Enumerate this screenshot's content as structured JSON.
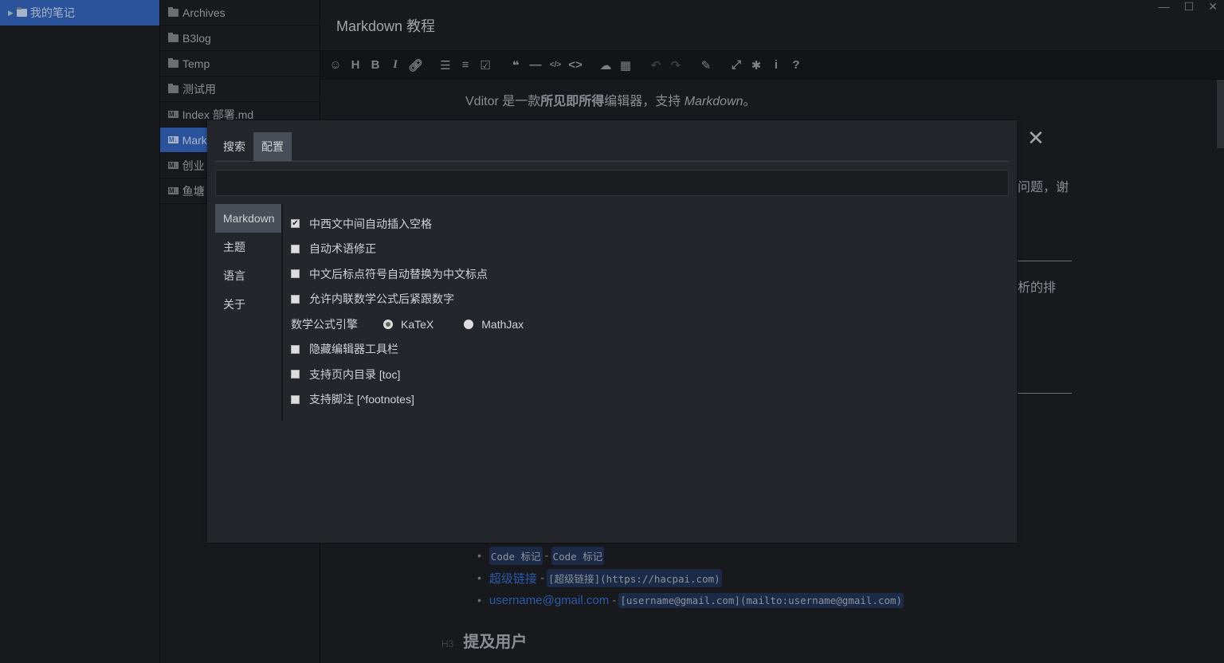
{
  "notebooks": [
    {
      "label": "我的笔记",
      "selected": true
    }
  ],
  "files": [
    {
      "label": "Archives",
      "type": "folder"
    },
    {
      "label": "B3log",
      "type": "folder"
    },
    {
      "label": "Temp",
      "type": "folder"
    },
    {
      "label": "测试用",
      "type": "folder"
    },
    {
      "label": "Index 部署.md",
      "type": "markdown"
    },
    {
      "label": "Markdown 教程",
      "type": "markdown",
      "selected": true
    },
    {
      "label": "创业",
      "type": "markdown"
    },
    {
      "label": "鱼塘",
      "type": "markdown"
    }
  ],
  "editor": {
    "title": "Markdown 教程",
    "toolbar": [
      "emoji",
      "headings",
      "bold",
      "italic",
      "link",
      "list",
      "ordered-list",
      "check",
      "quote",
      "line",
      "inline-code",
      "code",
      "upload",
      "table",
      "undo",
      "redo",
      "edit-mode",
      "fullscreen",
      "devtools",
      "info",
      "help"
    ],
    "intro": {
      "a": "Vditor 是一款",
      "b": "所见即所得",
      "c": "编辑器，支持 ",
      "d": "Markdown",
      "e": "。"
    },
    "frag1": "问题，谢",
    "frag2": "析的排",
    "list": [
      {
        "rendered": "Code 标记",
        "source": "Code 标记"
      },
      {
        "rendered": "超级链接",
        "source": "[超级链接](https://hacpai.com)"
      },
      {
        "rendered": "username@gmail.com",
        "source": "[username@gmail.com](mailto:username@gmail.com)"
      }
    ],
    "h3_marker": "H3",
    "h3": "提及用户"
  },
  "dialog": {
    "tabs": [
      {
        "label": "搜索"
      },
      {
        "label": "配置",
        "active": true
      }
    ],
    "search_value": "",
    "side": [
      {
        "label": "Markdown",
        "active": true
      },
      {
        "label": "主题"
      },
      {
        "label": "语言"
      },
      {
        "label": "关于"
      }
    ],
    "options": [
      {
        "label": "中西文中间自动插入空格",
        "checked": true
      },
      {
        "label": "自动术语修正",
        "checked": false
      },
      {
        "label": "中文后标点符号自动替换为中文标点",
        "checked": false
      },
      {
        "label": "允许内联数学公式后紧跟数字",
        "checked": false
      }
    ],
    "math_engine": {
      "label": "数学公式引擎",
      "choices": [
        "KaTeX",
        "MathJax"
      ],
      "selected": "KaTeX"
    },
    "options2": [
      {
        "label": "隐藏编辑器工具栏",
        "checked": false
      },
      {
        "label": "支持页内目录 [toc]",
        "checked": false
      },
      {
        "label": "支持脚注 [^footnotes]",
        "checked": false
      }
    ]
  },
  "colors": {
    "accent": "#2a539b",
    "bg": "#17191c",
    "dialog": "#23272b",
    "link": "#2a5bab"
  }
}
